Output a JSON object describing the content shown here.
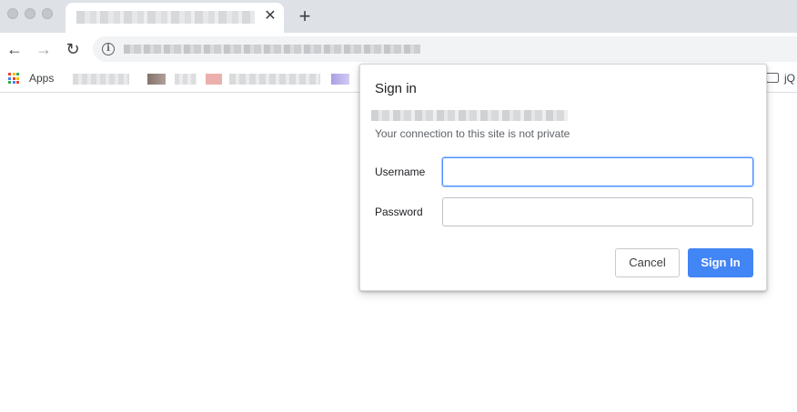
{
  "browser": {
    "tab": {
      "close_glyph": "✕"
    },
    "new_tab_glyph": "+",
    "nav": {
      "back_glyph": "←",
      "forward_glyph": "→",
      "reload_glyph": "↻"
    },
    "omnibox": {
      "info_glyph": "i"
    },
    "bookmarks": {
      "apps_label": "Apps",
      "folder_label": "jQ",
      "apps_colors": [
        "#ea4335",
        "#fbbc05",
        "#34a853",
        "#4285f4",
        "#ea4335",
        "#fbbc05",
        "#34a853",
        "#4285f4",
        "#ea4335"
      ]
    }
  },
  "dialog": {
    "title": "Sign in",
    "note": "Your connection to this site is not private",
    "username_label": "Username",
    "password_label": "Password",
    "username_value": "",
    "password_value": "",
    "cancel_label": "Cancel",
    "signin_label": "Sign In"
  },
  "colors": {
    "accent": "#4285f4",
    "focus_border": "#4d90fe",
    "tabstrip_bg": "#dee1e6"
  }
}
